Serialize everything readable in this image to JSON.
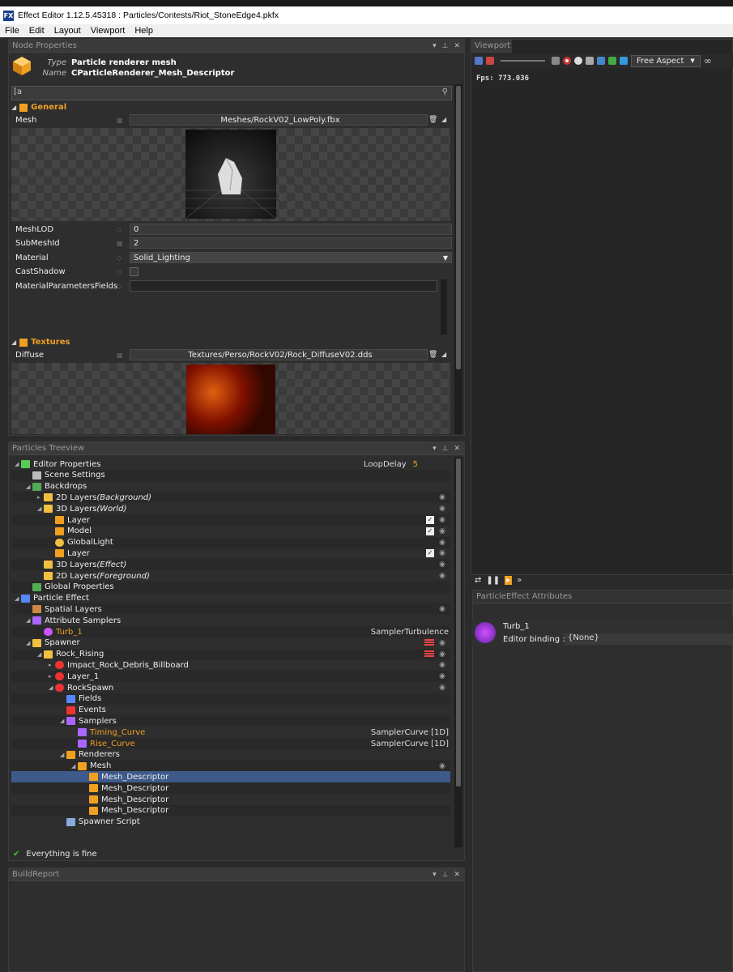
{
  "window": {
    "title": "Effect Editor 1.12.5.45318 : Particles/Contests/Riot_StoneEdge4.pkfx",
    "app_icon": "FX"
  },
  "menu": [
    "File",
    "Edit",
    "Layout",
    "Viewport",
    "Help"
  ],
  "node_properties": {
    "panel_title": "Node Properties",
    "type_label": "Type",
    "type_value": "Particle renderer mesh",
    "name_label": "Name",
    "name_value": "CParticleRenderer_Mesh_Descriptor",
    "general_section": "General",
    "mesh_label": "Mesh",
    "mesh_value": "Meshes/RockV02_LowPoly.fbx",
    "meshlod_label": "MeshLOD",
    "meshlod_value": "0",
    "submeshid_label": "SubMeshId",
    "submeshid_value": "2",
    "material_label": "Material",
    "material_value": "Solid_Lighting",
    "castshadow_label": "CastShadow",
    "matparams_label": "MaterialParametersFields",
    "textures_section": "Textures",
    "diffuse_label": "Diffuse",
    "diffuse_value": "Textures/Perso/RockV02/Rock_DiffuseV02.dds"
  },
  "treeview": {
    "panel_title": "Particles Treeview",
    "rows": [
      {
        "label": "Editor Properties",
        "right": "LoopDelay",
        "right_val": "5"
      },
      {
        "label": "Scene Settings"
      },
      {
        "label": "Backdrops"
      },
      {
        "label": "2D Layers",
        "suffix": "(Background)"
      },
      {
        "label": "3D Layers",
        "suffix": "(World)"
      },
      {
        "label": "Layer"
      },
      {
        "label": "Model"
      },
      {
        "label": "GlobalLight"
      },
      {
        "label": "Layer"
      },
      {
        "label": "3D Layers",
        "suffix": "(Effect)"
      },
      {
        "label": "2D Layers",
        "suffix": "(Foreground)"
      },
      {
        "label": "Global Properties"
      },
      {
        "label": "Particle Effect"
      },
      {
        "label": "Spatial Layers"
      },
      {
        "label": "Attribute Samplers"
      },
      {
        "label": "Turb_1",
        "right": "SamplerTurbulence"
      },
      {
        "label": "Spawner"
      },
      {
        "label": "Rock_Rising"
      },
      {
        "label": "Impact_Rock_Debris_Billboard"
      },
      {
        "label": "Layer_1"
      },
      {
        "label": "RockSpawn"
      },
      {
        "label": "Fields"
      },
      {
        "label": "Events"
      },
      {
        "label": "Samplers"
      },
      {
        "label": "Timing_Curve",
        "right": "SamplerCurve [1D]"
      },
      {
        "label": "Rise_Curve",
        "right": "SamplerCurve [1D]"
      },
      {
        "label": "Renderers"
      },
      {
        "label": "Mesh"
      },
      {
        "label": "Mesh_Descriptor"
      },
      {
        "label": "Mesh_Descriptor"
      },
      {
        "label": "Mesh_Descriptor"
      },
      {
        "label": "Mesh_Descriptor"
      },
      {
        "label": "Spawner Script"
      }
    ],
    "status": "Everything is fine"
  },
  "buildreport": {
    "panel_title": "BuildReport"
  },
  "viewport": {
    "panel_title": "Viewport",
    "aspect": "Free Aspect",
    "fps": "Fps: 773.036"
  },
  "attributes": {
    "panel_title": "ParticleEffect Attributes",
    "name": "Turb_1",
    "binding_label": "Editor binding :",
    "binding_value": "{None}"
  },
  "colors": {
    "accent": "#f0a020",
    "selection": "#3d5a8a"
  }
}
